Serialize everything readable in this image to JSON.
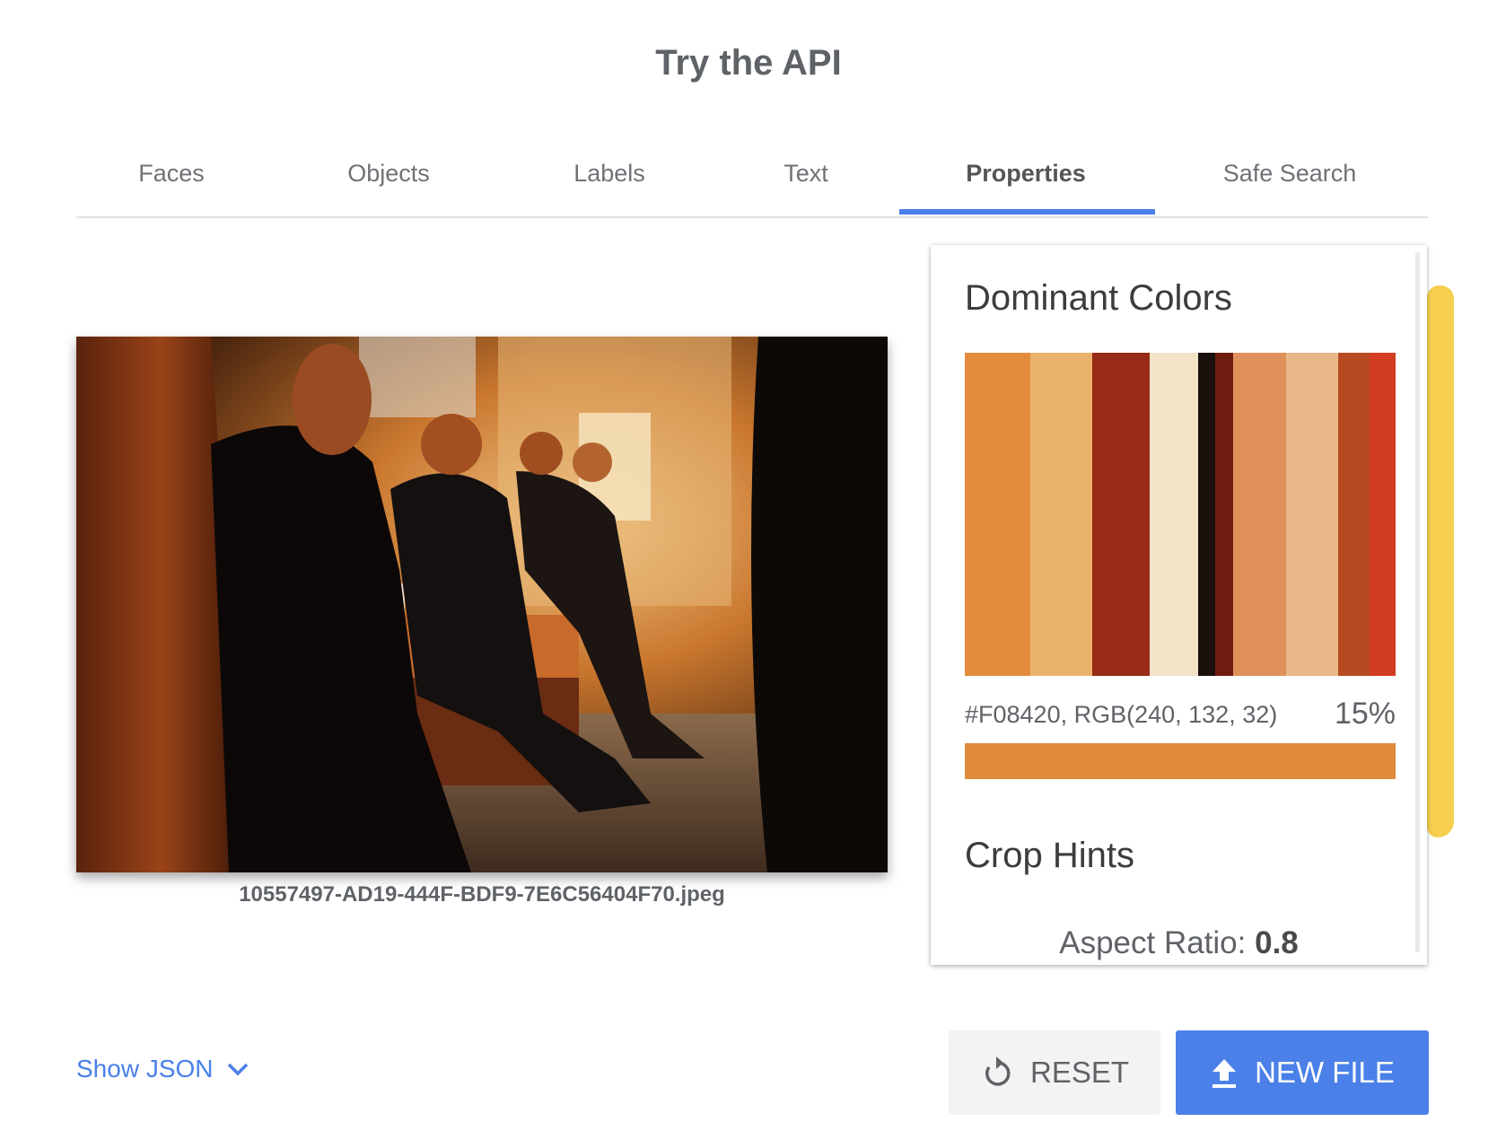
{
  "page": {
    "title": "Try the API"
  },
  "tabs": [
    {
      "label": "Faces"
    },
    {
      "label": "Objects"
    },
    {
      "label": "Labels"
    },
    {
      "label": "Text"
    },
    {
      "label": "Properties",
      "active": true
    },
    {
      "label": "Safe Search"
    }
  ],
  "image": {
    "filename": "10557497-AD19-444F-BDF9-7E6C56404F70.jpeg"
  },
  "properties": {
    "dominant_colors": {
      "title": "Dominant Colors",
      "swatches": [
        {
          "color": "#E38C3D",
          "share": 15
        },
        {
          "color": "#EBB26C",
          "share": 14
        },
        {
          "color": "#972B17",
          "share": 13
        },
        {
          "color": "#F2E3C7",
          "share": 11
        },
        {
          "color": "#1A100C",
          "share": 4
        },
        {
          "color": "#6E1C10",
          "share": 4
        },
        {
          "color": "#E0905A",
          "share": 12
        },
        {
          "color": "#E9B88A",
          "share": 12
        },
        {
          "color": "#B84A22",
          "share": 7
        },
        {
          "color": "#D23C22",
          "share": 6
        }
      ],
      "selected": {
        "info": "#F08420,  RGB(240, 132, 32)",
        "percent": "15%",
        "bar_color": "#E08A3B"
      }
    },
    "crop_hints": {
      "title": "Crop Hints",
      "aspect_label": "Aspect Ratio:",
      "aspect_value": "0.8"
    }
  },
  "footer": {
    "show_json": "Show JSON",
    "reset": "RESET",
    "new_file": "NEW FILE"
  },
  "colors": {
    "accent": "#4A80E8",
    "highlight": "#F6CF4F"
  },
  "icons": [
    "chevron-down-icon",
    "reset-icon",
    "upload-icon"
  ]
}
